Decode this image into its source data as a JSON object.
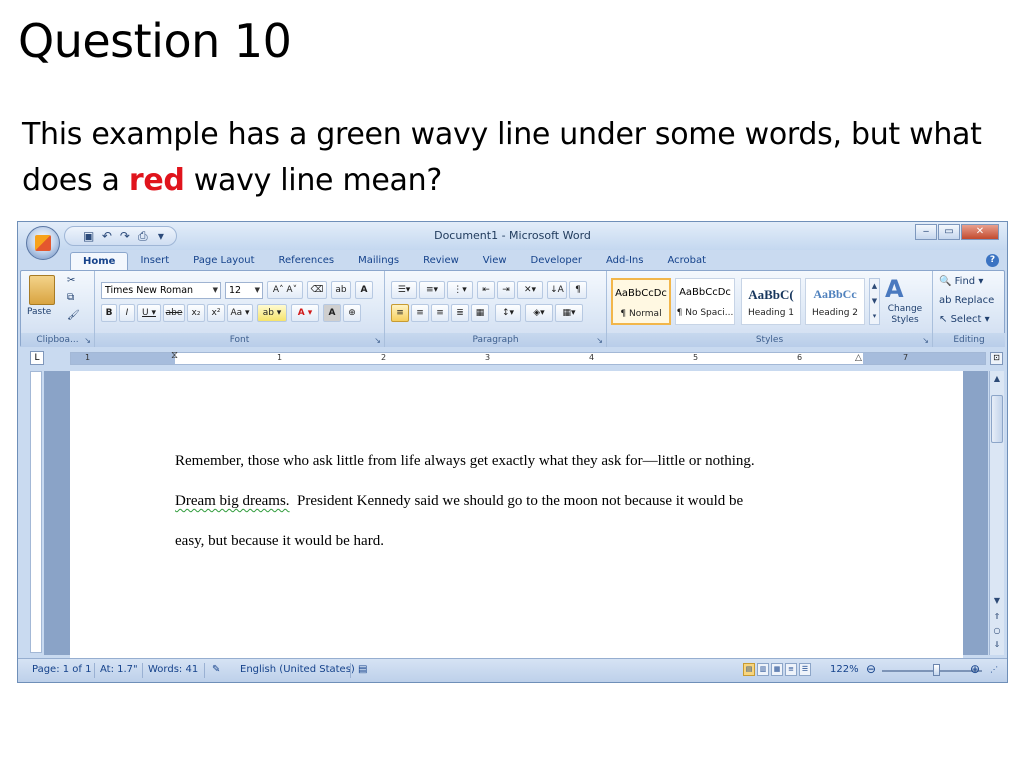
{
  "slide": {
    "title": "Question 10",
    "question_part1": "This example has a green wavy line under some words, but what does a ",
    "question_red": "red",
    "question_part2": " wavy line mean?"
  },
  "window": {
    "title": "Document1 - Microsoft Word",
    "qat": [
      "save-icon",
      "undo-icon",
      "redo-icon",
      "print-preview-icon"
    ]
  },
  "tabs": [
    "Home",
    "Insert",
    "Page Layout",
    "References",
    "Mailings",
    "Review",
    "View",
    "Developer",
    "Add-Ins",
    "Acrobat"
  ],
  "ribbon": {
    "clipboard": {
      "label": "Clipboa...",
      "paste": "Paste"
    },
    "font": {
      "label": "Font",
      "name": "Times New Roman",
      "size": "12"
    },
    "paragraph": {
      "label": "Paragraph"
    },
    "styles": {
      "label": "Styles",
      "items": [
        {
          "sample": "AaBbCcDc",
          "name": "¶ Normal"
        },
        {
          "sample": "AaBbCcDc",
          "name": "¶ No Spaci..."
        },
        {
          "sample": "AaBbC(",
          "name": "Heading 1"
        },
        {
          "sample": "AaBbCc",
          "name": "Heading 2"
        }
      ],
      "change_styles": "Change Styles"
    },
    "editing": {
      "label": "Editing",
      "find": "Find",
      "replace": "Replace",
      "select": "Select"
    }
  },
  "ruler": {
    "numbers": [
      "1",
      "1",
      "2",
      "3",
      "4",
      "5",
      "6",
      "7"
    ]
  },
  "document": {
    "line1": "Remember, those who ask little from life always get exactly what they ask for—little or nothing.",
    "line2_wavy": "Dream big dreams.",
    "line2_rest": "  President Kennedy said we should go to the moon not because it would be",
    "line3": "easy, but because it would be hard."
  },
  "status": {
    "page": "Page: 1 of 1",
    "at": "At: 1.7\"",
    "words": "Words: 41",
    "language": "English (United States)",
    "zoom": "122%",
    "zoom_level": 0.55
  },
  "colors": {
    "red_word": "#e0141c",
    "grammar_wavy": "#2e9b3a"
  }
}
